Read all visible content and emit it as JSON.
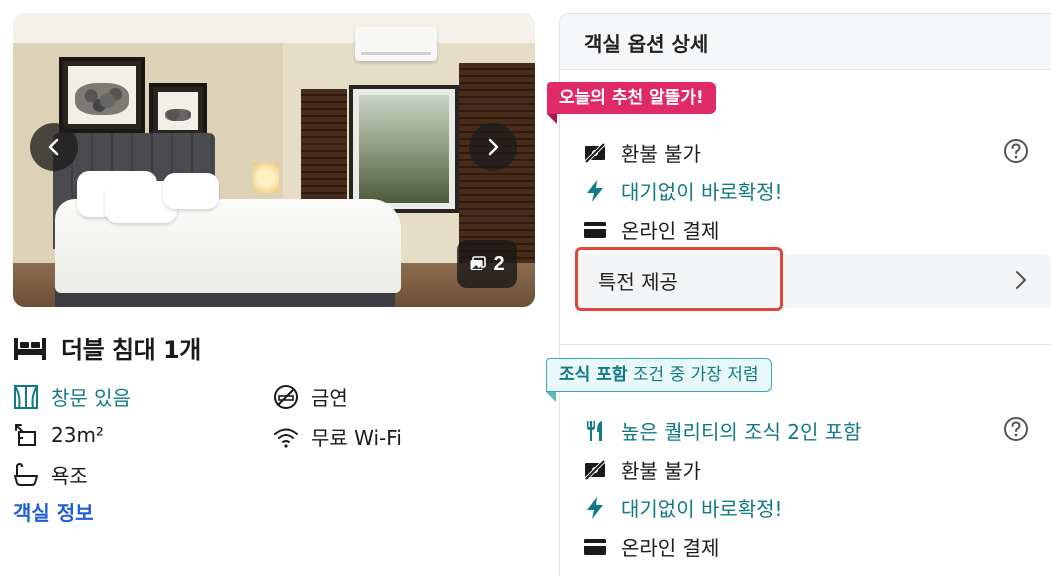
{
  "gallery": {
    "photo_count": "2",
    "prev_icon": "chevron-left-icon",
    "next_icon": "chevron-right-icon"
  },
  "room": {
    "bed_title": "더블 침대 1개",
    "features": {
      "window": "창문 있음",
      "size": "23m²",
      "bath": "욕조",
      "smoking": "금연",
      "wifi": "무료 Wi-Fi"
    },
    "info_link": "객실 정보"
  },
  "panel": {
    "title": "객실 옵션 상세",
    "option1": {
      "badge": "오늘의 추천 알뜰가!",
      "refund": "환불 불가",
      "instant": "대기없이 바로확정!",
      "payment": "온라인 결제",
      "benefit": "특전 제공"
    },
    "option2": {
      "badge_bold": "조식 포함",
      "badge_rest": " 조건 중 가장 저렴",
      "breakfast": "높은 퀄리티의 조식 2인 포함",
      "refund": "환불 불가",
      "instant": "대기없이 바로확정!",
      "payment": "온라인 결제"
    }
  },
  "colors": {
    "teal": "#127a86",
    "pink_badge": "#e02a66",
    "link_blue": "#1e5fd6",
    "highlight": "#e2453c"
  }
}
